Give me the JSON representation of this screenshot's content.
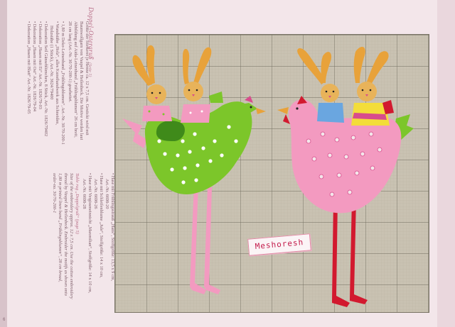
{
  "page": {
    "page_number": "6"
  },
  "text_column": {
    "title": "Doppel-Ostergruß",
    "title_page_ref": "(Seite 5)",
    "german_intro": [
      "Größe der Stickerei je Henne ca. 12 x 7,5 cm. Gestickt wird mit",
      "Baumwollgarn von Vaupel & Heilenbeck. Die Motive werden laut",
      "Abbildung auf Aida-Leinenband „Frühlingsblumen“ 26 cm breit,",
      "28 cm lang (Art.-Nr. 30/70-200-1) gearbeitet."
    ],
    "german_items": [
      "1,80 m Deko-Leinenband „Frühlingsblumen“, Art.-Nr. 30/70-200-1",
      "Wandstäbe „Holz“, alles Kunsthandwerk aus Schneiden,",
      "Holzstäbe (1 Stück), Art.-Nr. 3624/79400",
      "Dekoration Seil Gänseblümchen, 8 Stück, Art.-Nr. 1826/79402",
      "Dekoration „Hasen mit Ei“ Art.-Nr. 1826/79-03",
      "Dekoration „Hasen mit Ost“ Art.-Nr. 1826/79-04",
      "Dekoration „Hasen mit Blatt“ Art.-Nr. 1826/79-05"
    ],
    "english_title": "Table rug „Doppelgruß“ (page 5)",
    "english_intro": [
      "Size of the embroidery approx. 12 x 7,5 cm. Use the cotton embroidery",
      "thread by Vaupel & Heilenbeck. Embroider the motifs as shown onto",
      "1,80 m printed linen band „Frühlingsblumen“, 28 cm broad,",
      "order-no. 30/70-200-1"
    ],
    "right_items": [
      "Hase mit Frühlingsstrauß „Hans“, Stoffgröße: 13,5 x 9 cm,",
      "Art.-Nr. 6698-20",
      "Hase mit Schleifenblume „Jule“, Stoffgröße: 14 x 10 cm,",
      "Art.-Nr. 6698-26",
      "Hase mit Vergissmeinnicht „Maxmilian“, Stoffgröße: 14 x 10 cm,",
      "Art.-Nr. 6698-28"
    ]
  },
  "chart": {
    "colors": {
      "fabric": "#c9c2b2",
      "green": "#7cc62a",
      "dark_green": "#3f8a1a",
      "pink": "#f39ac0",
      "dark_pink": "#d84c8c",
      "red": "#d2192f",
      "orange": "#e8a23a",
      "tan": "#e8b35a",
      "blue": "#6aa6e0",
      "yellow": "#f3dd3a",
      "white": "#ffffff"
    },
    "signature": "Meshoresh"
  }
}
